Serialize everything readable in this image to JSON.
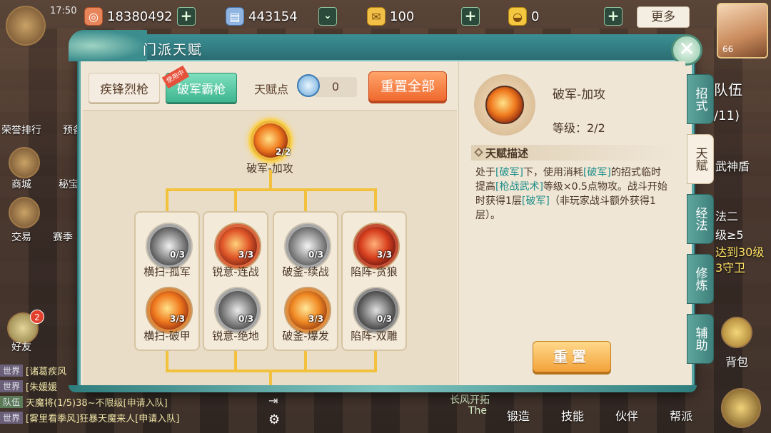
{
  "status": {
    "time": "17:50"
  },
  "resources": [
    {
      "name": "copper-coin-icon",
      "value": "18380492"
    },
    {
      "name": "silver-note-icon",
      "value": "443154"
    },
    {
      "name": "gold-scroll-icon",
      "value": "100"
    },
    {
      "name": "gold-ingot-icon",
      "value": "0"
    }
  ],
  "more_label": "更多",
  "avatar_level": "66",
  "side_left": {
    "labels": [
      "荣誉排行",
      "预备",
      "商城",
      "秘宝",
      "交易",
      "赛季",
      "好友"
    ],
    "friend_badge": "2"
  },
  "chat": [
    {
      "tag": "世界",
      "text": "[诸葛疾风"
    },
    {
      "tag": "世界",
      "text": "[朱媛媛"
    },
    {
      "tag": "队伍",
      "text": "天魔将(1/5)38~不限级[申请入队]"
    },
    {
      "tag": "世界",
      "text": "[雾里看季风]狂暴天魔来人[申请入队]"
    }
  ],
  "bottom_nav": [
    "锻造",
    "技能",
    "伙伴",
    "帮派"
  ],
  "bottom_misc": {
    "banner": "长风开拓",
    "sub": "The"
  },
  "right_side": {
    "backpack": "背包"
  },
  "background_right_text": [
    "队伍",
    "/11)",
    "武神盾",
    "法二",
    "级≥5",
    "达到30级",
    "3守卫"
  ],
  "panel": {
    "title": "门派天赋",
    "close_icon": "close-icon",
    "subtabs": [
      {
        "label": "疾锋烈枪",
        "active": false
      },
      {
        "label": "破军霸枪",
        "active": true,
        "badge": "使用中"
      }
    ],
    "talent_points_label": "天赋点",
    "talent_points_value": "0",
    "reset_all_label": "重置全部",
    "side_tabs": [
      "招式",
      "天赋",
      "经法",
      "修炼",
      "辅助"
    ],
    "active_side_tab": 1
  },
  "tree": {
    "root": {
      "label": "破军-加攻",
      "count": "2/2",
      "color": "#f07a1e"
    },
    "columns": [
      {
        "nodes": [
          {
            "label": "横扫-孤军",
            "count": "0/3",
            "color": "#9a9a9a"
          },
          {
            "label": "横扫-破甲",
            "count": "3/3",
            "color": "#f07a1e"
          }
        ]
      },
      {
        "nodes": [
          {
            "label": "锐意-连战",
            "count": "3/3",
            "color": "#e0572a"
          },
          {
            "label": "锐意-绝地",
            "count": "0/3",
            "color": "#8c8c8c"
          }
        ]
      },
      {
        "nodes": [
          {
            "label": "破釜-续战",
            "count": "0/3",
            "color": "#a0a0a0"
          },
          {
            "label": "破釜-爆发",
            "count": "3/3",
            "color": "#f08a24"
          }
        ]
      },
      {
        "nodes": [
          {
            "label": "陷阵-贪狼",
            "count": "3/3",
            "color": "#d8401e"
          },
          {
            "label": "陷阵-双雕",
            "count": "0/3",
            "color": "#7a7a7a"
          }
        ]
      }
    ]
  },
  "detail": {
    "name": "破军-加攻",
    "level": "等级：2/2",
    "desc_title": "天赋描述",
    "desc_parts": [
      {
        "t": "处于",
        "h": false
      },
      {
        "t": "[破军]",
        "h": true
      },
      {
        "t": "下，使用消耗",
        "h": false
      },
      {
        "t": "[破军]",
        "h": true
      },
      {
        "t": "的招式临时提高",
        "h": false
      },
      {
        "t": "[枪战武术]",
        "h": true
      },
      {
        "t": "等级×0.5点物攻。战斗开始时获得1层",
        "h": false
      },
      {
        "t": "[破军]",
        "h": true
      },
      {
        "t": "（非玩家战斗额外获得1层）。",
        "h": false
      }
    ],
    "reset_label": "重置"
  }
}
